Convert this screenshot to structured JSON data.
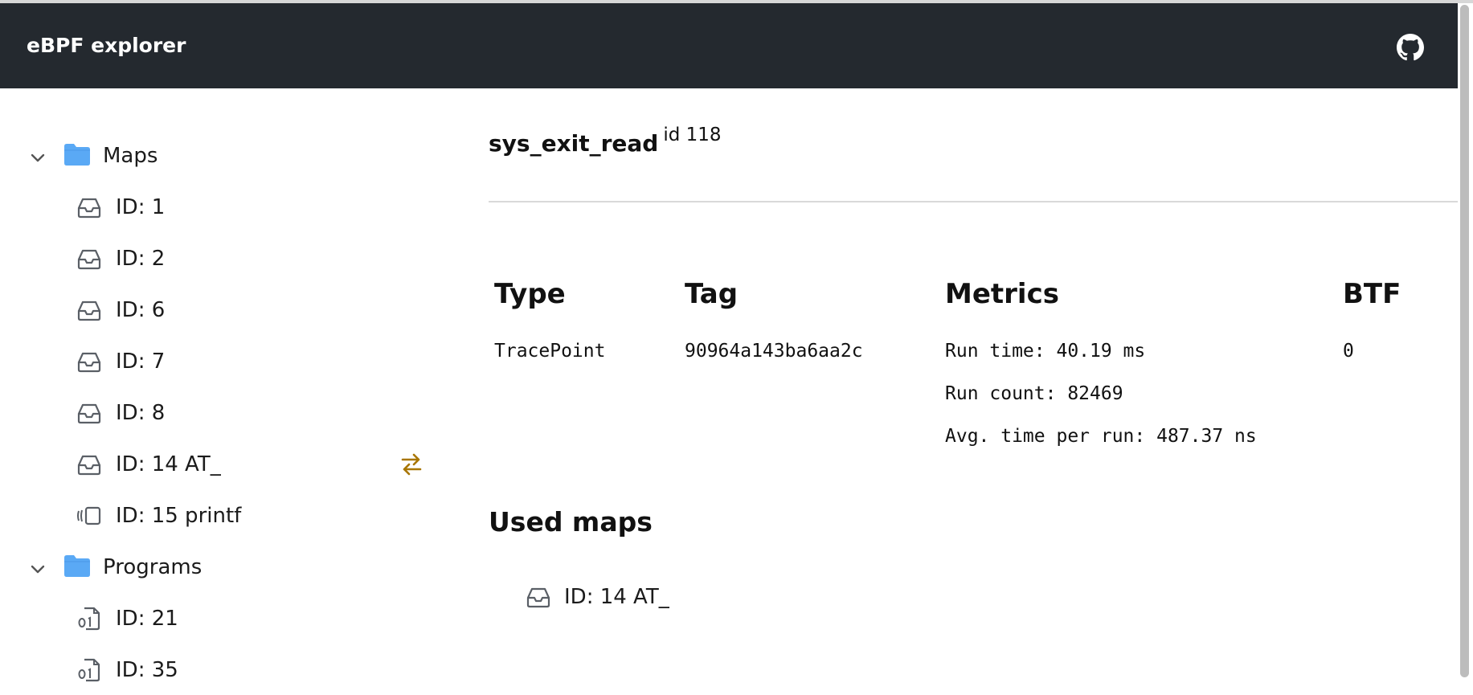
{
  "header": {
    "app_title": "eBPF explorer",
    "github_icon": "github-icon",
    "background_color": "#24292f"
  },
  "sidebar": {
    "maps_folder": {
      "label": "Maps",
      "icon": "folder-icon",
      "expanded": true
    },
    "maps": [
      {
        "label": "ID: 1",
        "icon": "inbox-icon"
      },
      {
        "label": "ID: 2",
        "icon": "inbox-icon"
      },
      {
        "label": "ID: 6",
        "icon": "inbox-icon"
      },
      {
        "label": "ID: 7",
        "icon": "inbox-icon"
      },
      {
        "label": "ID: 8",
        "icon": "inbox-icon"
      },
      {
        "label": "ID: 14 AT_",
        "icon": "inbox-icon",
        "badge_icon": "swap-arrows-icon",
        "badge_color": "#a87600"
      },
      {
        "label": "ID: 15 printf",
        "icon": "ring-buffer-icon"
      }
    ],
    "programs_folder": {
      "label": "Programs",
      "icon": "folder-icon",
      "expanded": true
    },
    "programs": [
      {
        "label": "ID: 21",
        "icon": "binary-file-icon"
      },
      {
        "label": "ID: 35",
        "icon": "binary-file-icon"
      }
    ],
    "folder_color": "#5aa9f5"
  },
  "program": {
    "name": "sys_exit_read",
    "id_text": "id 118",
    "columns": {
      "type_header": "Type",
      "tag_header": "Tag",
      "metrics_header": "Metrics",
      "btf_header": "BTF"
    },
    "type_value": "TracePoint",
    "tag_value": "90964a143ba6aa2c",
    "metrics": {
      "run_time": "Run time: 40.19 ms",
      "run_count": "Run count: 82469",
      "avg_time": "Avg. time per run: 487.37 ns"
    },
    "btf_value": "0",
    "used_maps_title": "Used maps",
    "used_maps": [
      {
        "label": "ID: 14 AT_",
        "icon": "inbox-icon"
      }
    ]
  }
}
